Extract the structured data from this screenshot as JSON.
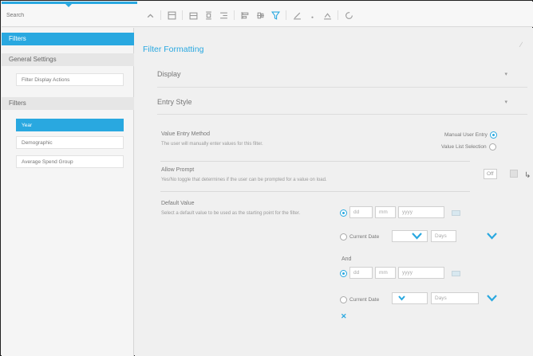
{
  "search": {
    "placeholder": "Search"
  },
  "sidebar": {
    "filters_header": "Filters",
    "general_settings": "General Settings",
    "general_items": [
      "Filter Display Actions"
    ],
    "filters_group": "Filters",
    "filter_items": [
      "Year",
      "Demographic",
      "Average Spend Group"
    ]
  },
  "main": {
    "title": "Filter Formatting",
    "display_label": "Display",
    "entry_style_label": "Entry Style",
    "value_entry_method": {
      "label": "Value Entry Method",
      "description": "The user will manually enter values for this filter.",
      "options": [
        "Manual User Entry",
        "Value List Selection"
      ]
    },
    "allow_prompt": {
      "label": "Allow Prompt",
      "description": "Yes/No toggle that determines if the user can be prompted for a value on load.",
      "value": "Off"
    },
    "default_value": {
      "label": "Default Value",
      "description": "Select a default value to be used as the starting point for the filter.",
      "from": {
        "day": "dd",
        "month": "mm",
        "year": "yyyy",
        "current_period": "Current Date",
        "period_unit": "Days"
      },
      "and_label": "And",
      "to": {
        "day": "dd",
        "month": "mm",
        "year": "yyyy",
        "current_period": "Current Date",
        "period_unit": "Days"
      }
    }
  },
  "colors": {
    "accent": "#29a8e0"
  }
}
